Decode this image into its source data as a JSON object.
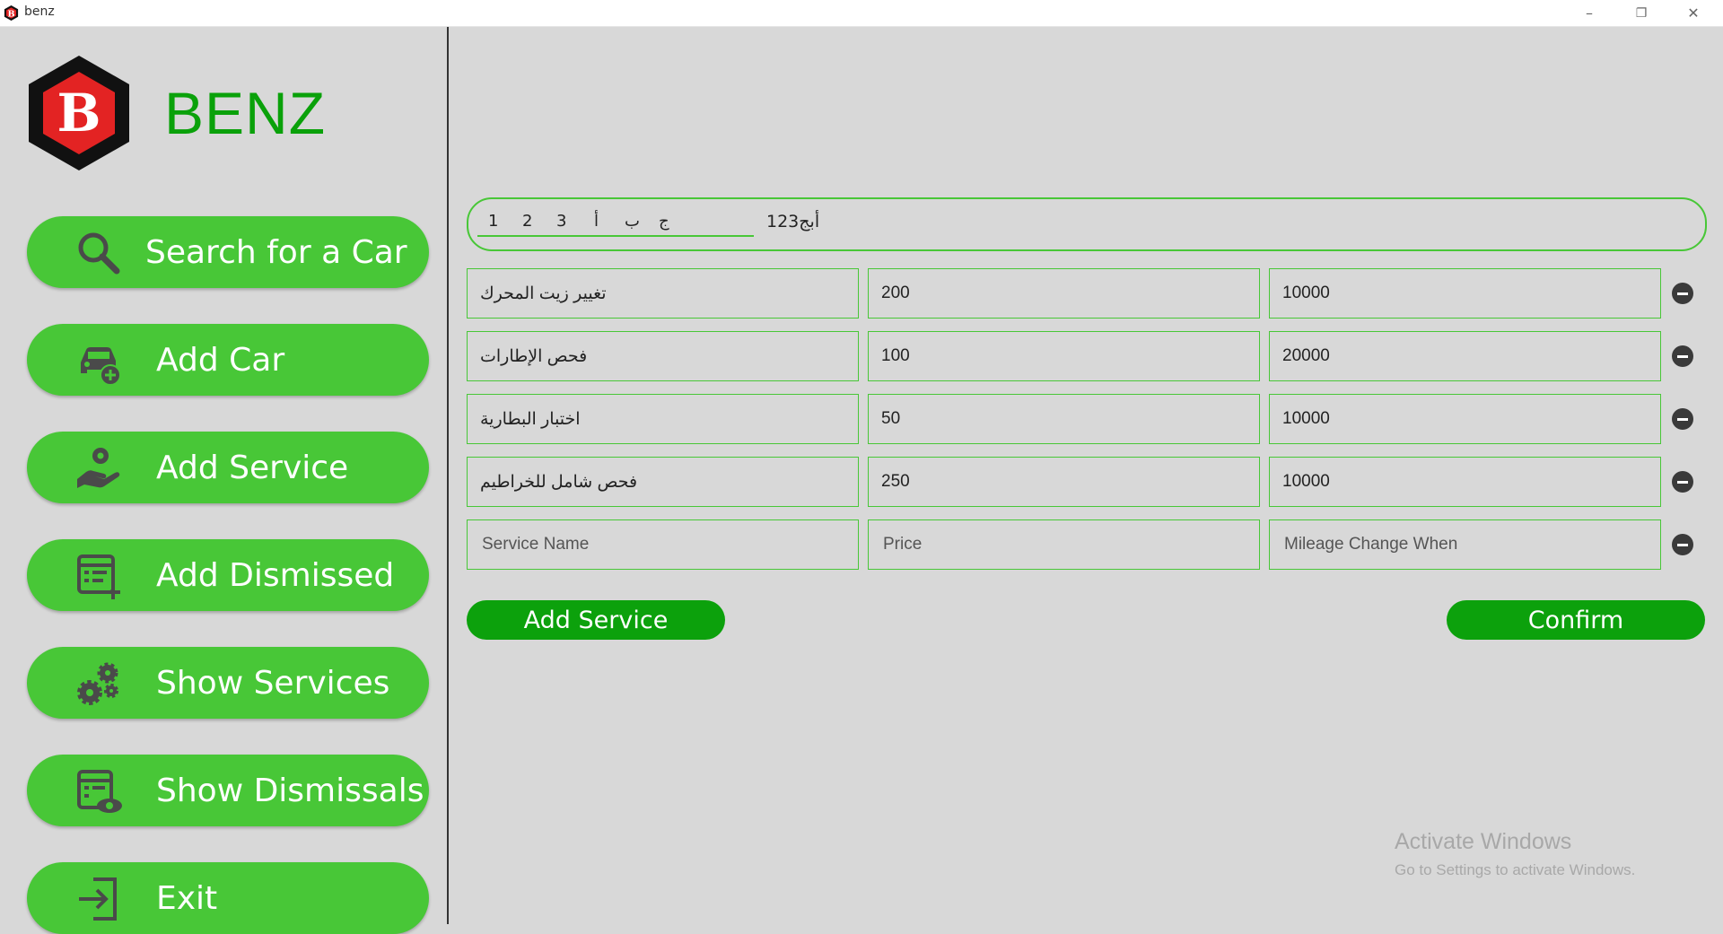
{
  "window": {
    "title": "benz",
    "minimize": "–",
    "restore": "❐",
    "close": "✕"
  },
  "brand": {
    "name": "BENZ",
    "logo_letter": "B",
    "accent": "#0aa10a",
    "logo_red": "#e32323"
  },
  "sidebar": {
    "items": [
      {
        "label": "Search for a Car",
        "icon": "search-icon"
      },
      {
        "label": "Add Car",
        "icon": "add-car-icon"
      },
      {
        "label": "Add Service",
        "icon": "service-hand-icon"
      },
      {
        "label": "Add Dismissed",
        "icon": "add-list-icon"
      },
      {
        "label": "Show Services",
        "icon": "gears-icon"
      },
      {
        "label": "Show Dismissals",
        "icon": "view-list-icon"
      },
      {
        "label": "Exit",
        "icon": "exit-icon"
      }
    ],
    "button_color": "#48c737"
  },
  "tabs": {
    "items": [
      "1",
      "2",
      "3",
      "أ",
      "ب",
      "ج"
    ],
    "title": "أبج123"
  },
  "services": {
    "rows": [
      {
        "name": "تغيير زيت المحرك",
        "price": "200",
        "mileage": "10000"
      },
      {
        "name": "فحص الإطارات",
        "price": "100",
        "mileage": "20000"
      },
      {
        "name": "اختبار البطارية",
        "price": "50",
        "mileage": "10000"
      },
      {
        "name": "فحص شامل للخراطيم",
        "price": "250",
        "mileage": "10000"
      }
    ],
    "new_row": {
      "name_placeholder": "Service Name",
      "price_placeholder": "Price",
      "mileage_placeholder": "Mileage Change When"
    }
  },
  "actions": {
    "add_service": "Add Service",
    "confirm": "Confirm"
  },
  "watermark": {
    "line1": "Activate Windows",
    "line2": "Go to Settings to activate Windows."
  }
}
